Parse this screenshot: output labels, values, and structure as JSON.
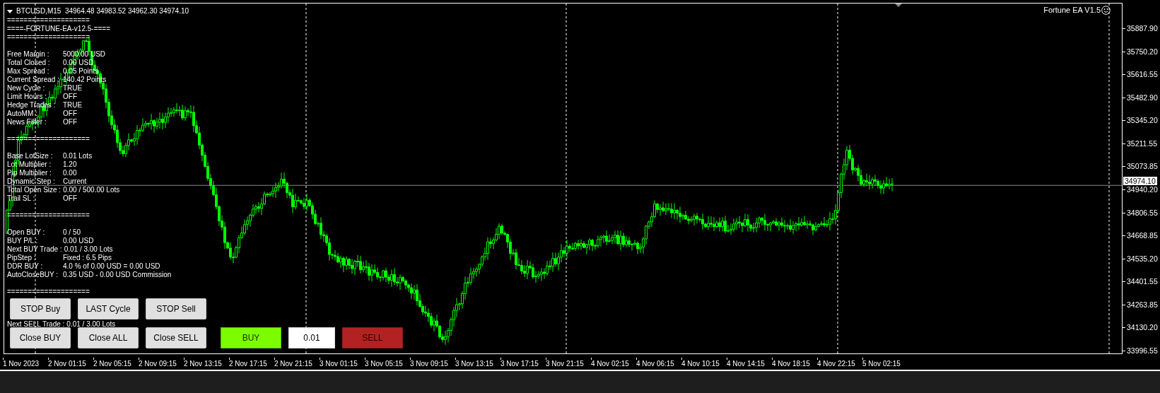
{
  "chart": {
    "symbol_line": "BTCUSD,M15  34964.48 34983.52 34962.30 34974.10",
    "ea_label": "Fortune EA V1.5",
    "current_price": "34974.10"
  },
  "info_panel": {
    "header": [
      "====================",
      "====-FORTUNE-EA-v12.5-====",
      "===================="
    ],
    "sections": [
      {
        "rows": [
          {
            "label": "Free Margin :",
            "value": "5000.00 USD"
          },
          {
            "label": "Total Closed :",
            "value": "0.00 USD"
          },
          {
            "label": "Max Spread :",
            "value": "0.05 Points"
          },
          {
            "label": "Current Spread :",
            "value": "140.42 Points"
          },
          {
            "label": "New Cycle :",
            "value": "TRUE"
          },
          {
            "label": "Limit Hours :",
            "value": "OFF"
          },
          {
            "label": "Hedge Trades :",
            "value": "TRUE"
          },
          {
            "label": "AutoMM :",
            "value": "OFF"
          },
          {
            "label": "News Filter :",
            "value": "OFF"
          }
        ]
      },
      {
        "separator": "====================",
        "rows": [
          {
            "label": "Base LotSize :",
            "value": "0.01 Lots"
          },
          {
            "label": "Lot Multiplier :",
            "value": "1.20"
          },
          {
            "label": "Pip Multiplier :",
            "value": "0.00"
          },
          {
            "label": "Dynamic Step :",
            "value": "Current"
          },
          {
            "label": "Total Open Size :",
            "value": "0.00 / 500.00 Lots"
          },
          {
            "label": "Trail SL :",
            "value": "OFF"
          }
        ]
      },
      {
        "separator": "====================",
        "rows": [
          {
            "label": "Open BUY :",
            "value": "0 / 50"
          },
          {
            "label": "BUY P/L :",
            "value": "0.00 USD"
          },
          {
            "label": "Next BUY Trade :",
            "value": "0.01 / 3.00 Lots"
          },
          {
            "label": "PipStep :",
            "value": "Fixed : 6.5 Pips"
          },
          {
            "label": "DDR BUY :",
            "value": "4.0 % of 0.00 USD = 0.00 USD"
          },
          {
            "label": "AutoCloseBUY :",
            "value": "0.35 USD - 0.00 USD Commission"
          }
        ]
      },
      {
        "separator": "====================",
        "rows": [
          {
            "label": "Next SELL Trade :",
            "value": "0.01 / 3.00 Lots"
          }
        ]
      }
    ]
  },
  "button_rows": [
    {
      "buttons": [
        {
          "kind": "gray",
          "label": "STOP Buy"
        },
        {
          "kind": "gray",
          "label": "LAST Cycle"
        },
        {
          "kind": "gray",
          "label": "STOP Sell"
        }
      ]
    },
    {
      "buttons": [
        {
          "kind": "gray",
          "label": "Close BUY"
        },
        {
          "kind": "gray",
          "label": "Close ALL"
        },
        {
          "kind": "gray",
          "label": "Close SELL"
        },
        {
          "kind": "buy",
          "label": "BUY"
        },
        {
          "kind": "lot",
          "label": "0.01"
        },
        {
          "kind": "sell",
          "label": "SELL"
        }
      ]
    }
  ],
  "price_axis": [
    "35887.90",
    "35750.20",
    "35616.55",
    "35482.90",
    "35345.20",
    "35211.55",
    "35073.85",
    "34940.20",
    "34806.55",
    "34668.85",
    "34535.20",
    "34401.55",
    "34263.85",
    "34130.20",
    "33996.55"
  ],
  "time_axis": [
    "1 Nov 2023",
    "2 Nov 01:15",
    "2 Nov 05:15",
    "2 Nov 09:15",
    "2 Nov 13:15",
    "2 Nov 17:15",
    "2 Nov 21:15",
    "3 Nov 01:15",
    "3 Nov 05:15",
    "3 Nov 09:15",
    "3 Nov 13:15",
    "3 Nov 17:15",
    "3 Nov 21:15",
    "4 Nov 02:15",
    "4 Nov 06:15",
    "4 Nov 10:15",
    "4 Nov 14:15",
    "4 Nov 18:15",
    "4 Nov 22:15",
    "5 Nov 02:15"
  ]
}
